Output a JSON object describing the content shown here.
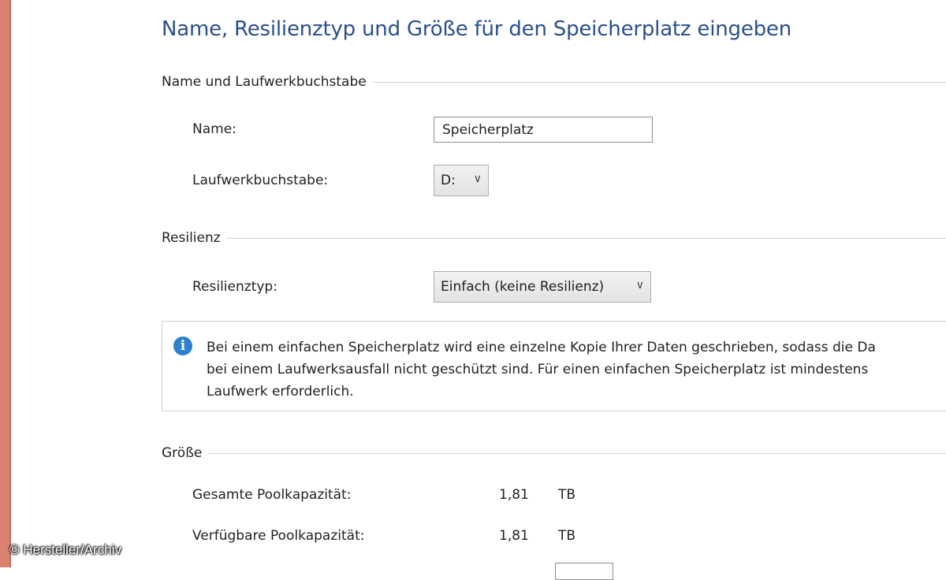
{
  "heading": "Name, Resilienztyp und Größe für den Speicherplatz eingeben",
  "sections": {
    "name": {
      "title": "Name und Laufwerkbuchstabe",
      "name_label": "Name:",
      "name_value": "Speicherplatz",
      "drive_label": "Laufwerkbuchstabe:",
      "drive_value": "D:"
    },
    "resilience": {
      "title": "Resilienz",
      "type_label": "Resilienztyp:",
      "type_value": "Einfach (keine Resilienz)",
      "info_lines": [
        "Bei einem einfachen Speicherplatz wird eine einzelne Kopie Ihrer Daten geschrieben, sodass die Da",
        "bei einem Laufwerksausfall nicht geschützt sind. Für einen einfachen Speicherplatz ist mindestens",
        "Laufwerk erforderlich."
      ]
    },
    "size": {
      "title": "Größe",
      "total_label": "Gesamte Poolkapazität:",
      "total_value": "1,81",
      "total_unit": "TB",
      "available_label": "Verfügbare Poolkapazität:",
      "available_value": "1,81",
      "available_unit": "TB"
    }
  },
  "icons": {
    "info": "info-icon",
    "dropdown": "chevron-down-icon"
  },
  "colors": {
    "heading": "#2a4f8f",
    "info_icon": "#2d7fd0",
    "left_border": "#d9826f"
  },
  "copyright": "© Hersteller/Archiv"
}
